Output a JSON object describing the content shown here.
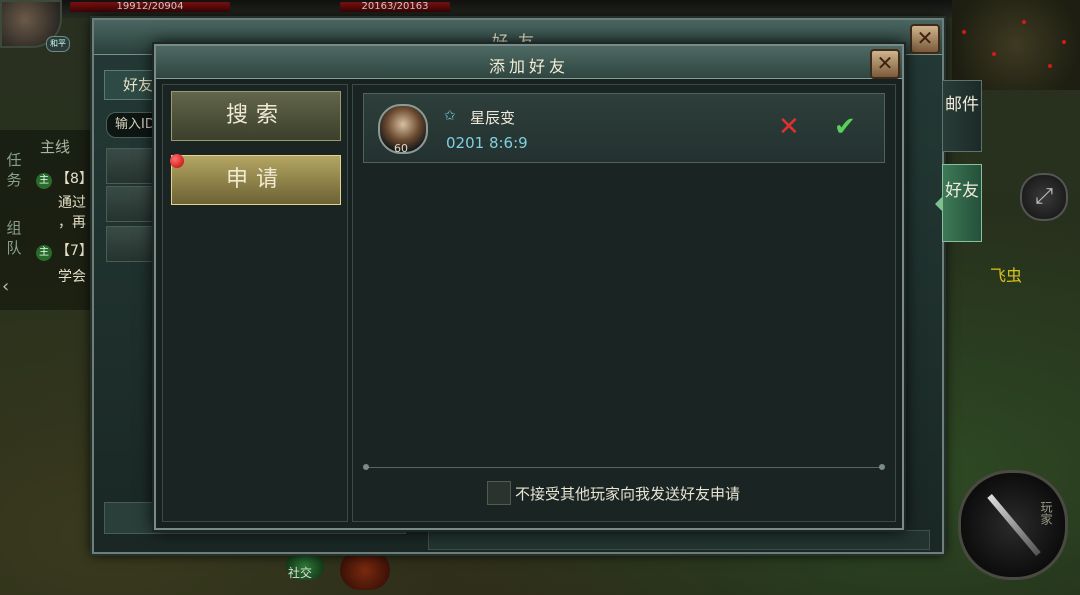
{
  "hud": {
    "hp_left": "19912/20904",
    "hp_right": "20163/20163",
    "peace_badge": "和平",
    "skill_label": "玩家",
    "mob_label": "飞虫",
    "bottom_label": "社交"
  },
  "quest": {
    "title": "主线",
    "vtab_tasks": "任务",
    "vtab_team": "组队",
    "items": [
      {
        "tag": "主",
        "text": "【8】"
      },
      {
        "text": "通过"
      },
      {
        "text": "，再"
      },
      {
        "tag": "主",
        "text": "【7】"
      },
      {
        "text": "学会"
      }
    ]
  },
  "friend_window": {
    "title": "好友",
    "tab_label": "好友",
    "id_input_placeholder": "输入ID"
  },
  "side_tabs": {
    "mail": "邮件",
    "friends": "好友"
  },
  "add_friend_dialog": {
    "title": "添加好友",
    "menu": {
      "search": "搜索",
      "apply": "申请"
    },
    "requests": [
      {
        "name": "星辰变",
        "level": "60",
        "time": "0201 8:6:9"
      }
    ],
    "reject_icon": "✕",
    "accept_icon": "✔",
    "block_requests_label": "不接受其他玩家向我发送好友申请"
  },
  "colors": {
    "accent_gold": "#b4a662",
    "reject_red": "#e03030",
    "accept_green": "#5ad05a",
    "time_cyan": "#7fd0e0"
  }
}
